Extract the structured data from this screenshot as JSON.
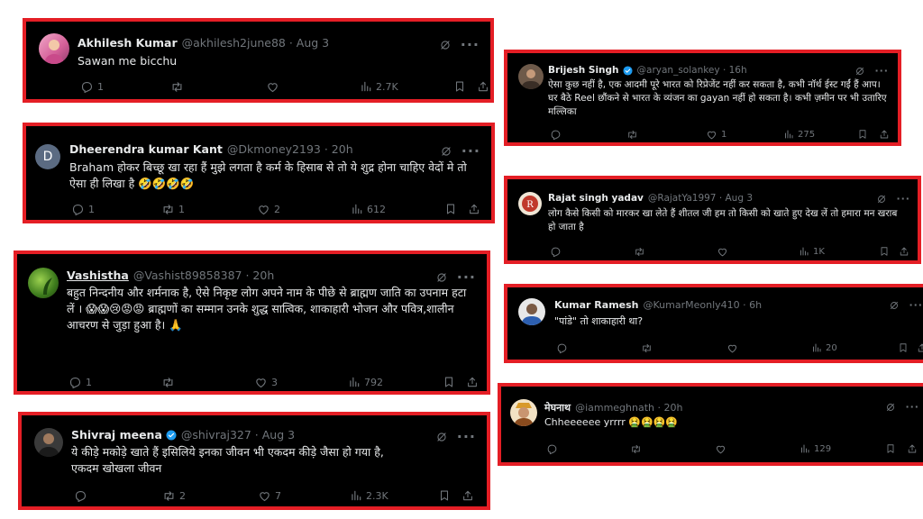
{
  "colors": {
    "frame": "#e41e25",
    "bg": "#000000",
    "text": "#e7e9ea",
    "muted": "#71767b",
    "verified": "#1d9bf0"
  },
  "tweets": [
    {
      "name": "Akhilesh Kumar",
      "handle": "@akhilesh2june88 · Aug 3",
      "text": "Sawan me bicchu",
      "counts": {
        "reply": "1",
        "retweet": "",
        "like": "",
        "views": "2.7K"
      }
    },
    {
      "name": "Dheerendra kumar Kant",
      "handle": "@Dkmoney2193 · 20h",
      "avatar_letter": "D",
      "text": "Braham होकर बिच्छू खा रहा हैं मुझे लगता है कर्म के हिसाब से तो ये शुद्र होना चाहिए वेदों मे तो ऐसा ही लिखा है 🤣🤣🤣🤣",
      "counts": {
        "reply": "1",
        "retweet": "1",
        "like": "2",
        "views": "612"
      }
    },
    {
      "name": "Vashistha",
      "handle": "@Vashist89858387 · 20h",
      "text": "बहुत निन्दनीय और शर्मनाक है, ऐसे निकृष्ट लोग अपने नाम के पीछे से ब्राह्मण जाति का उपनाम हटा\nलें । 😱😱😢😡😡 ब्राह्मणों का सम्मान उनके शुद्ध सात्विक, शाकाहारी भोजन और पवित्र,शालीन\nआचरण से जुड़ा हुआ है। 🙏",
      "counts": {
        "reply": "1",
        "retweet": "",
        "like": "3",
        "views": "792"
      }
    },
    {
      "name": "Shivraj meena",
      "handle": "@shivraj327 · Aug 3",
      "text": "ये कीड़े मकोड़े खाते हैं इसिलिये इनका जीवन भी एकदम कीड़े जैसा हो गया है,\nएकदम खोखला जीवन",
      "counts": {
        "reply": "",
        "retweet": "2",
        "like": "7",
        "views": "2.3K"
      }
    },
    {
      "name": "Brijesh Singh",
      "handle": "@aryan_solankey · 16h",
      "text": "ऐसा कुछ नहीं है, एक आदमी पूरे भारत को रिप्रेजेंट नहीं कर सकता है, कभी नॉर्थ ईस्ट गईं हैं आप। घर बैठे Reel छौंकने से भारत के व्यंजन का gayan नहीं हो सकता है। कभी ज़मीन पर भी उतारिए मल्लिका",
      "counts": {
        "reply": "",
        "retweet": "",
        "like": "1",
        "views": "275"
      }
    },
    {
      "name": "Rajat singh yadav",
      "handle": "@RajatYa1997 · Aug 3",
      "text": "लोग कैसे किसी को मारकर खा लेते हैं शीतल जी हम तो किसी को खाते हुए देख लें तो हमारा मन खराब हो जाता है",
      "counts": {
        "reply": "",
        "retweet": "",
        "like": "",
        "views": "1K"
      }
    },
    {
      "name": "Kumar Ramesh",
      "handle": "@KumarMeonly410 · 6h",
      "text": "\"पांडे\" तो शाकाहारी था?",
      "counts": {
        "reply": "",
        "retweet": "",
        "like": "",
        "views": "20"
      }
    },
    {
      "name": "मेघनाथ",
      "handle": "@iammeghnath · 20h",
      "text": "Chheeeeee yrrrr 🤮🤮🤮🤮",
      "counts": {
        "reply": "",
        "retweet": "",
        "like": "",
        "views": "129"
      }
    }
  ]
}
